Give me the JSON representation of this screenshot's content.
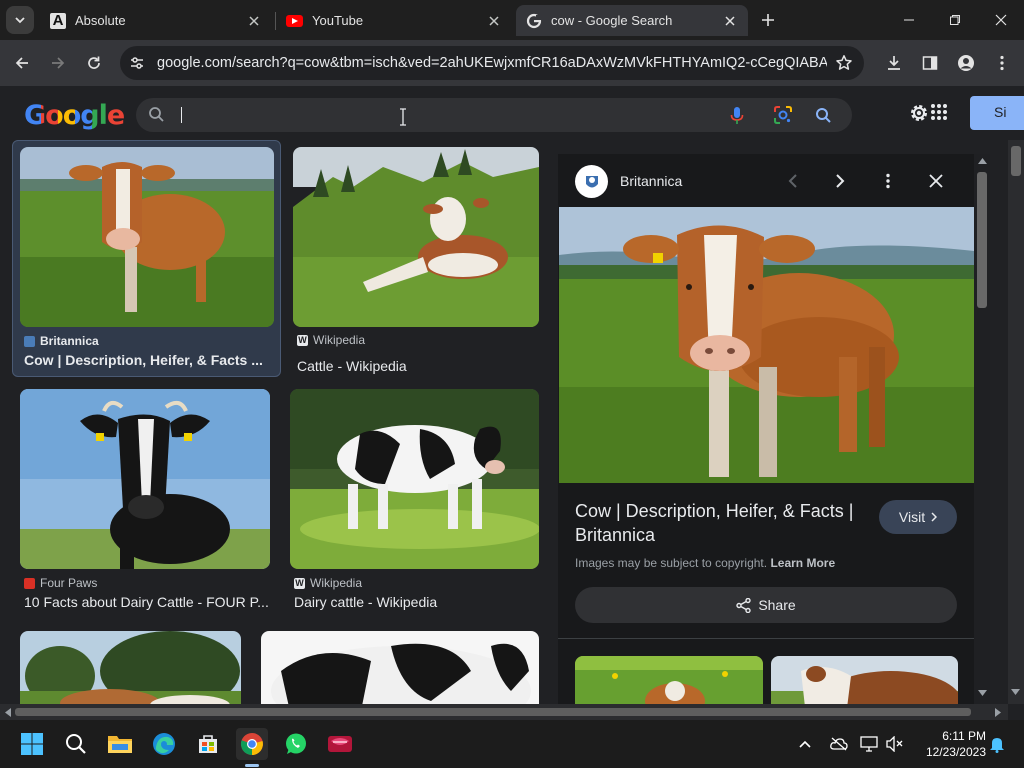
{
  "browser": {
    "tabs": [
      {
        "title": "Absolute",
        "active": false
      },
      {
        "title": "YouTube",
        "active": false
      },
      {
        "title": "cow - Google Search",
        "active": true
      }
    ],
    "url": "google.com/search?q=cow&tbm=isch&ved=2ahUKEwjxmfCR16aDAxWzMVkFHTHYAmIQ2-cCegQIABAA&..."
  },
  "google": {
    "logo": "Google",
    "search_value": "",
    "signin_label": "Si"
  },
  "results": [
    {
      "source": "Britannica",
      "title": "Cow | Description, Heifer, & Facts ...",
      "fav_color": "#4a7cb8"
    },
    {
      "source": "Wikipedia",
      "title": "Cattle - Wikipedia",
      "fav_color": "#e8eaed"
    },
    {
      "source": "Four Paws",
      "title": "10 Facts about Dairy Cattle - FOUR P...",
      "fav_color": "#d93025"
    },
    {
      "source": "Wikipedia",
      "title": "Dairy cattle - Wikipedia",
      "fav_color": "#e8eaed"
    }
  ],
  "panel": {
    "source": "Britannica",
    "title": "Cow | Description, Heifer, & Facts | Britannica",
    "visit_label": "Visit",
    "copyright_text": "Images may be subject to copyright.",
    "learn_more": "Learn More",
    "share_label": "Share"
  },
  "taskbar": {
    "time": "6:11 PM",
    "date": "12/23/2023"
  },
  "colors": {
    "accent": "#8ab4f8",
    "panel_bg": "#18191b",
    "page_bg": "#202124"
  }
}
